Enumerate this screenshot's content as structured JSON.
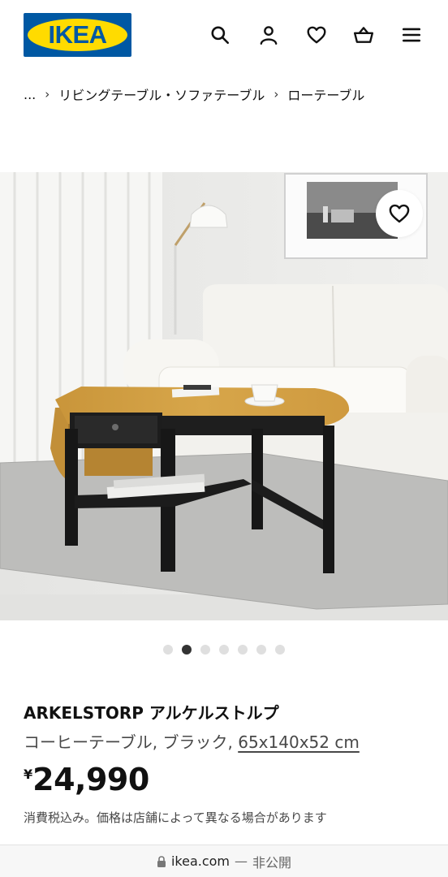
{
  "header": {
    "logo_text": "IKEA",
    "icons": [
      "search-icon",
      "user-icon",
      "heart-icon",
      "cart-icon",
      "menu-icon"
    ]
  },
  "breadcrumb": {
    "ellipsis": "...",
    "item1": "リビングテーブル・ソファテーブル",
    "item2": "ローテーブル"
  },
  "gallery": {
    "image_count": 7,
    "active_index": 1
  },
  "product": {
    "name": "ARKELSTORP アルケルストルプ",
    "description": "コーヒーテーブル, ブラック, ",
    "dimensions": "65x140x52 cm",
    "currency": "¥",
    "price": "24,990",
    "tax_note": "消費税込み。価格は店舗によって異なる場合があります"
  },
  "browser": {
    "domain": "ikea.com",
    "separator": " — ",
    "status": "非公開"
  },
  "colors": {
    "brand_blue": "#0058a3",
    "brand_yellow": "#ffdb00"
  }
}
